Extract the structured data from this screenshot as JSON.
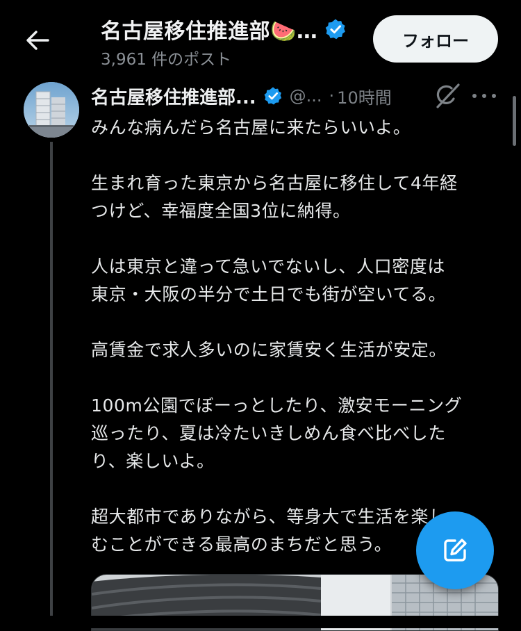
{
  "header": {
    "title": "名古屋移住推進部🍉…",
    "post_count": "3,961 件のポスト",
    "follow_label": "フォロー"
  },
  "tweet": {
    "display_name": "名古屋移住推進部...",
    "handle": "@...",
    "separator": "·",
    "time": "10時間",
    "paragraphs": [
      [
        "みんな病んだら名古屋に来たらいいよ。"
      ],
      [
        "生まれ育った東京から名古屋に移住して4年経",
        "つけど、幸福度全国3位に納得。"
      ],
      [
        "人は東京と違って急いでないし、人口密度は",
        "東京・大阪の半分で土日でも街が空いてる。"
      ],
      [
        "高賃金で求人多いのに家賃安く生活が安定。"
      ],
      [
        "100m公園でぼーっとしたり、激安モーニング",
        "巡ったり、夏は冷たいきしめん食べ比べした",
        "り、楽しいよ。"
      ],
      [
        "超大都市でありながら、等身大で生活を楽し",
        "むことができる最高のまちだと思う。"
      ]
    ]
  },
  "icons": {
    "back": "arrow-left-icon",
    "verified": "verified-badge-icon",
    "grok": "grok-icon",
    "more": "more-horizontal-icon",
    "compose": "compose-icon"
  },
  "colors": {
    "background": "#000000",
    "accent": "#1d9bf0",
    "text": "#e7e9ea",
    "secondary_text": "#7d8287",
    "follow_button_bg": "#eff3f4"
  }
}
